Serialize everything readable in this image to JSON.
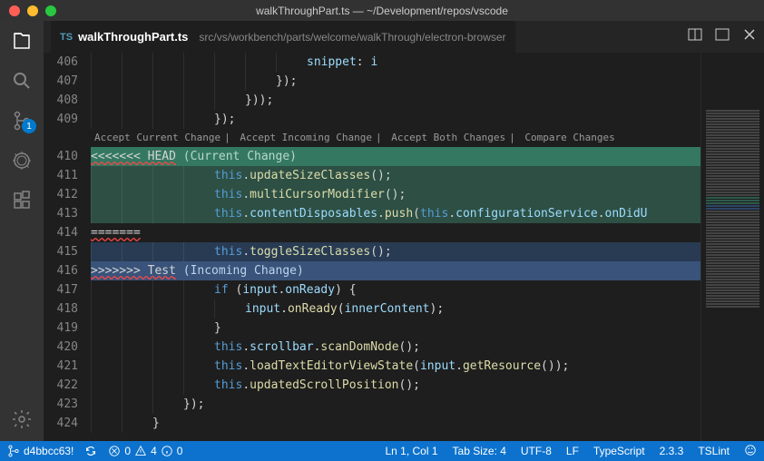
{
  "window": {
    "title": "walkThroughPart.ts — ~/Development/repos/vscode",
    "traffic_colors": {
      "close": "#ff5f57",
      "min": "#febc2e",
      "max": "#28c840"
    }
  },
  "activity": {
    "scm_badge": "1"
  },
  "tab": {
    "icon": "TS",
    "filename": "walkThroughPart.ts",
    "path": "src/vs/workbench/parts/welcome/walkThrough/electron-browser"
  },
  "codelens": {
    "a": "Accept Current Change",
    "b": "Accept Incoming Change",
    "c": "Accept Both Changes",
    "d": "Compare Changes"
  },
  "gutter_start": 406,
  "lines": {
    "l406": "                    snippet: i",
    "l407": "                });",
    "l408": "            }));",
    "l409": "        });",
    "head_marker": "<<<<<<< HEAD",
    "head_label": " (Current Change)",
    "l411": "this.updateSizeClasses();",
    "l412": "this.multiCursorModifier();",
    "l413a": "this.contentDisposables.push(",
    "l413b": "this.configurationService.onDidU",
    "sep": "=======",
    "l415": "this.toggleSizeClasses();",
    "inc_marker": ">>>>>>> Test",
    "inc_label": " (Incoming Change)",
    "l417a": "if",
    "l417b": " (input.onReady) {",
    "l418": "input.onReady(innerContent);",
    "l419": "}",
    "l420": "this.scrollbar.scanDomNode();",
    "l421a": "this.loadTextEditorViewState(input.",
    "l421b": "getResource",
    "l421c": "());",
    "l422": "this.updatedScrollPosition();",
    "l423": "});",
    "l424": "}"
  },
  "status": {
    "branch": "d4bbcc63!",
    "errors": "0",
    "warnings": "4",
    "info": "0",
    "cursor": "Ln 1, Col 1",
    "tab_size": "Tab Size: 4",
    "encoding": "UTF-8",
    "eol": "LF",
    "lang": "TypeScript",
    "version": "2.3.3",
    "lint": "TSLint"
  }
}
